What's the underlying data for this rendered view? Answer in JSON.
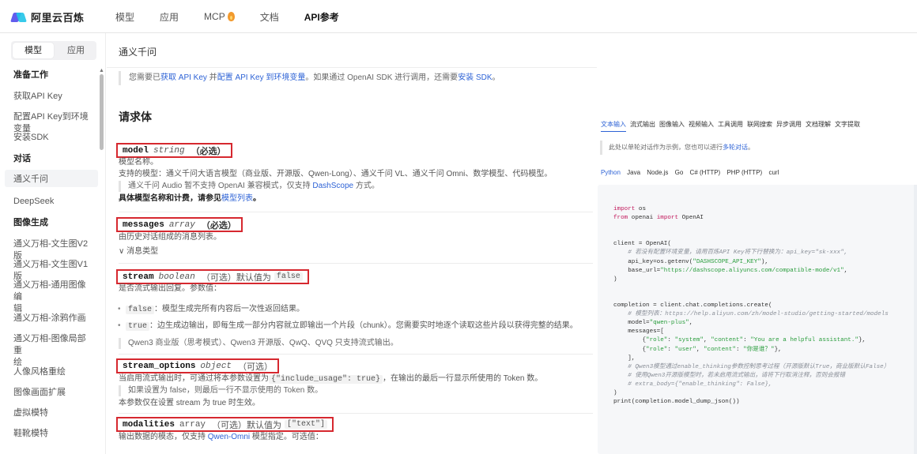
{
  "brand": {
    "name": "阿里云百炼"
  },
  "topnav": {
    "items": [
      {
        "label": "模型",
        "active": false
      },
      {
        "label": "应用",
        "active": false
      },
      {
        "label": "MCP",
        "active": false,
        "icon": "flame-icon"
      },
      {
        "label": "文档",
        "active": false
      },
      {
        "label": "API参考",
        "active": true
      }
    ]
  },
  "sidebar": {
    "tabs": [
      "模型",
      "应用"
    ],
    "active_tab": "模型",
    "items": [
      {
        "label": "准备工作",
        "group": true
      },
      {
        "label": "获取API Key"
      },
      {
        "label": "配置API Key到环境变量"
      },
      {
        "label": "安装SDK"
      },
      {
        "label": "对话",
        "group": true
      },
      {
        "label": "通义千问",
        "selected": true
      },
      {
        "label": "DeepSeek"
      },
      {
        "label": "图像生成",
        "group": true
      },
      {
        "label": "通义万相-文生图V2版"
      },
      {
        "label": "通义万相-文生图V1版"
      },
      {
        "label": "通义万相-通用图像编"
      },
      {
        "label": "辑"
      },
      {
        "label": "通义万相-涂鸦作画"
      },
      {
        "label": "通义万相-图像局部重"
      },
      {
        "label": "绘"
      },
      {
        "label": "人像风格重绘"
      },
      {
        "label": "图像画面扩展"
      },
      {
        "label": "虚拟模特"
      },
      {
        "label": "鞋靴模特"
      }
    ]
  },
  "page": {
    "title": "通义千问",
    "notice": {
      "p1": "您需要已",
      "l1": "获取 API Key",
      "p2": " 并",
      "l2": "配置 API Key 到环境变量",
      "p3": "。如果通过 OpenAI SDK 进行调用，还需要",
      "l3": "安装 SDK",
      "p4": "。"
    },
    "section_title": "请求体",
    "params": {
      "model": {
        "name": "model",
        "type": "string",
        "req": "（必选）",
        "desc": "模型名称。",
        "supported": "支持的模型：通义千问大语言模型（商业版、开源版、Qwen-Long）、通义千问 VL、通义千问 Omni、数学模型、代码模型。",
        "quote_a": "通义千问 Audio 暂不支持 OpenAI 兼容模式，仅支持 ",
        "quote_link": "DashScope",
        "quote_b": " 方式。",
        "pricing_a": "具体模型名称和计费，请参见",
        "pricing_link": "模型列表",
        "pricing_b": "。"
      },
      "messages": {
        "name": "messages",
        "type": "array",
        "req": "（必选）",
        "desc": "由历史对话组成的消息列表。",
        "expand": "∨ 消息类型"
      },
      "stream": {
        "name": "stream",
        "type": "boolean",
        "flag": "（可选）默认值为",
        "default": "false",
        "desc": "是否流式输出回复。参数值：",
        "b1_code": "false",
        "b1_text": "：模型生成完所有内容后一次性返回结果。",
        "b2_code": "true",
        "b2_text": "：边生成边输出，即每生成一部分内容就立即输出一个片段（chunk）。您需要实时地逐个读取这些片段以获得完整的结果。",
        "note": "Qwen3 商业版（思考模式）、Qwen3 开源版、QwQ、QVQ 只支持流式输出。"
      },
      "stream_options": {
        "name": "stream_options",
        "type": "object",
        "flag": "（可选）",
        "desc_a": "当启用流式输出时，可通过将本参数设置为",
        "desc_code": "{\"include_usage\": true}",
        "desc_b": "，在输出的最后一行显示所使用的 Token 数。",
        "quote": "如果设置为 false，则最后一行不显示使用的 Token 数。",
        "note": "本参数仅在设置 stream 为 true 时生效。"
      },
      "modalities": {
        "name": "modalities",
        "type": "array",
        "flag": "（可选）默认值为",
        "default": "[\"text\"]",
        "desc_a": "输出数据的模态，仅支持 ",
        "desc_link": "Qwen-Omni",
        "desc_b": " 模型指定。可选值："
      }
    }
  },
  "right_panel": {
    "lang_tabs": [
      "文本输入",
      "流式输出",
      "图像输入",
      "视频输入",
      "工具调用",
      "联网搜索",
      "异步调用",
      "文档理解",
      "文字提取"
    ],
    "active_lang_tab": "文本输入",
    "note_a": "此处以单轮对话作为示例，您也可以进行",
    "note_link": "多轮对话",
    "note_b": "。",
    "code_tabs": [
      "Python",
      "Java",
      "Node.js",
      "Go",
      "C# (HTTP)",
      "PHP (HTTP)",
      "curl"
    ],
    "active_code_tab": "Python",
    "code": {
      "l1_kw": "import",
      "l1": " os",
      "l2_kw1": "from",
      "l2_a": " openai ",
      "l2_kw2": "import",
      "l2_b": " OpenAI",
      "l3": "client = OpenAI(",
      "l4": "    # 若没有配置环境变量，请用百炼API Key将下行替换为：api_key=\"sk-xxx\",",
      "l5_a": "    api_key=os.getenv(",
      "l5_s": "\"DASHSCOPE_API_KEY\"",
      "l5_b": "),",
      "l6_a": "    base_url=",
      "l6_s": "\"https://dashscope.aliyuncs.com/compatible-mode/v1\"",
      "l6_b": ",",
      "l7": ")",
      "l8": "completion = client.chat.completions.create(",
      "l9": "    # 模型列表：https://help.aliyun.com/zh/model-studio/getting-started/models",
      "l10_a": "    model=",
      "l10_s": "\"qwen-plus\"",
      "l10_b": ",",
      "l11": "    messages=[",
      "l12_a": "        {",
      "l12_s1": "\"role\"",
      "l12_b": ": ",
      "l12_s2": "\"system\"",
      "l12_c": ", ",
      "l12_s3": "\"content\"",
      "l12_d": ": ",
      "l12_s4": "\"You are a helpful assistant.\"",
      "l12_e": "},",
      "l13_a": "        {",
      "l13_s1": "\"role\"",
      "l13_b": ": ",
      "l13_s2": "\"user\"",
      "l13_c": ", ",
      "l13_s3": "\"content\"",
      "l13_d": ": ",
      "l13_s4": "\"你是谁？\"",
      "l13_e": "},",
      "l14": "    ],",
      "l15": "    # Qwen3模型通过enable_thinking参数控制思考过程（开源版默认True，商业版默认False）",
      "l16": "    # 使用Qwen3开源版模型时，若未启用流式输出，请将下行取消注释，否则会报错",
      "l17": "    # extra_body={\"enable_thinking\": False},",
      "l18": ")",
      "l19": "print(completion.model_dump_json())"
    }
  }
}
